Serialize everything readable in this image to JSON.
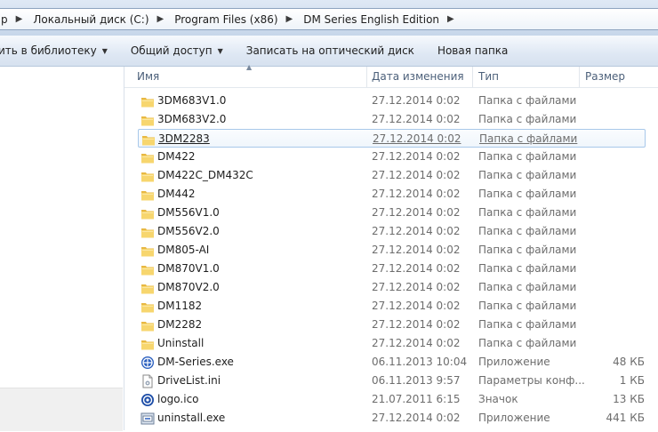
{
  "breadcrumb": [
    "р",
    "Локальный диск (C:)",
    "Program Files (x86)",
    "DM Series English Edition"
  ],
  "toolbar": [
    {
      "label": "ить в библиотеку",
      "dropdown": true
    },
    {
      "label": "Общий доступ",
      "dropdown": true
    },
    {
      "label": "Записать на оптический диск",
      "dropdown": false
    },
    {
      "label": "Новая папка",
      "dropdown": false
    }
  ],
  "columns": {
    "name": "Имя",
    "date": "Дата изменения",
    "type": "Тип",
    "size": "Размер"
  },
  "files": [
    {
      "name": "3DM683V1.0",
      "date": "27.12.2014 0:02",
      "type": "Папка с файлами",
      "size": "",
      "icon": "folder-icon"
    },
    {
      "name": "3DM683V2.0",
      "date": "27.12.2014 0:02",
      "type": "Папка с файлами",
      "size": "",
      "icon": "folder-icon"
    },
    {
      "name": "3DM2283",
      "date": "27.12.2014 0:02",
      "type": "Папка с файлами",
      "size": "",
      "icon": "folder-icon",
      "hover": true
    },
    {
      "name": "DM422",
      "date": "27.12.2014 0:02",
      "type": "Папка с файлами",
      "size": "",
      "icon": "folder-icon"
    },
    {
      "name": "DM422C_DM432C",
      "date": "27.12.2014 0:02",
      "type": "Папка с файлами",
      "size": "",
      "icon": "folder-icon"
    },
    {
      "name": "DM442",
      "date": "27.12.2014 0:02",
      "type": "Папка с файлами",
      "size": "",
      "icon": "folder-icon"
    },
    {
      "name": "DM556V1.0",
      "date": "27.12.2014 0:02",
      "type": "Папка с файлами",
      "size": "",
      "icon": "folder-icon"
    },
    {
      "name": "DM556V2.0",
      "date": "27.12.2014 0:02",
      "type": "Папка с файлами",
      "size": "",
      "icon": "folder-icon"
    },
    {
      "name": "DM805-AI",
      "date": "27.12.2014 0:02",
      "type": "Папка с файлами",
      "size": "",
      "icon": "folder-icon"
    },
    {
      "name": "DM870V1.0",
      "date": "27.12.2014 0:02",
      "type": "Папка с файлами",
      "size": "",
      "icon": "folder-icon"
    },
    {
      "name": "DM870V2.0",
      "date": "27.12.2014 0:02",
      "type": "Папка с файлами",
      "size": "",
      "icon": "folder-icon"
    },
    {
      "name": "DM1182",
      "date": "27.12.2014 0:02",
      "type": "Папка с файлами",
      "size": "",
      "icon": "folder-icon"
    },
    {
      "name": "DM2282",
      "date": "27.12.2014 0:02",
      "type": "Папка с файлами",
      "size": "",
      "icon": "folder-icon"
    },
    {
      "name": "Uninstall",
      "date": "27.12.2014 0:02",
      "type": "Папка с файлами",
      "size": "",
      "icon": "folder-icon"
    },
    {
      "name": "DM-Series.exe",
      "date": "06.11.2013 10:04",
      "type": "Приложение",
      "size": "48 КБ",
      "icon": "app-exe-icon"
    },
    {
      "name": "DriveList.ini",
      "date": "06.11.2013 9:57",
      "type": "Параметры конф...",
      "size": "1 КБ",
      "icon": "ini-file-icon"
    },
    {
      "name": "logo.ico",
      "date": "21.07.2011 6:15",
      "type": "Значок",
      "size": "13 КБ",
      "icon": "ico-file-icon"
    },
    {
      "name": "uninstall.exe",
      "date": "27.12.2014 0:02",
      "type": "Приложение",
      "size": "441 КБ",
      "icon": "uninstall-exe-icon"
    }
  ]
}
